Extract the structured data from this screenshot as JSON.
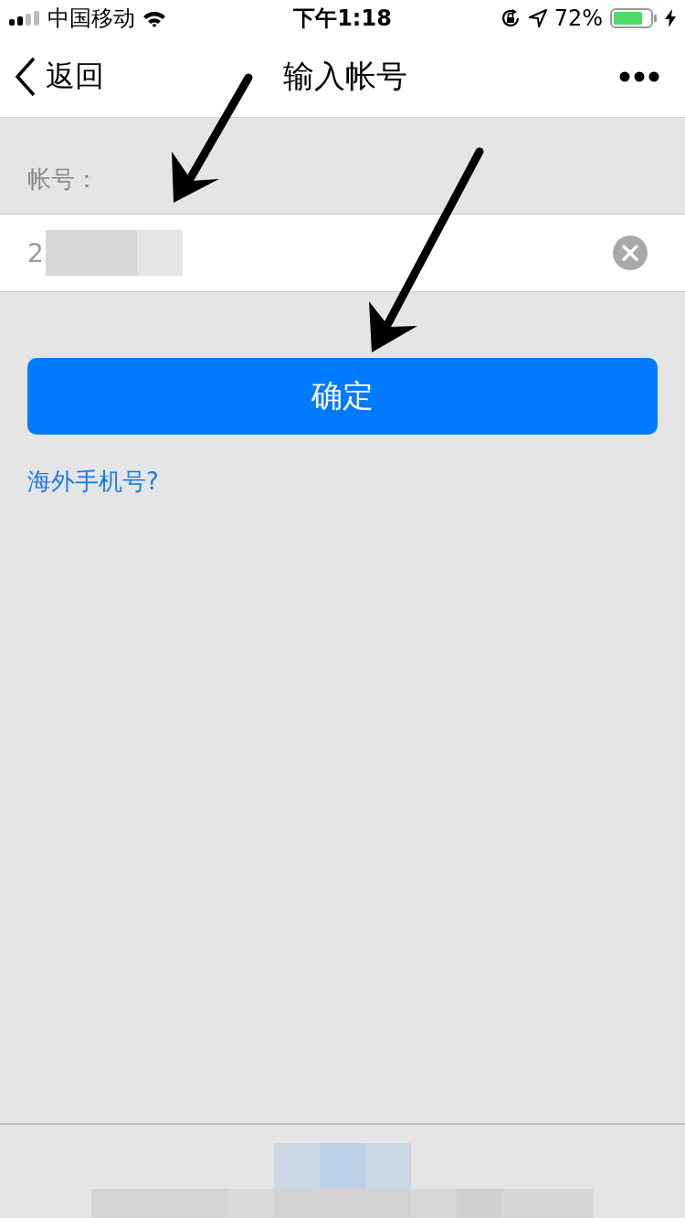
{
  "status_bar": {
    "carrier": "中国移动",
    "time": "下午1:18",
    "battery": "72%"
  },
  "nav_bar": {
    "back": "返回",
    "title": "输入帐号"
  },
  "form": {
    "label": "帐号：",
    "value": "2",
    "button": "确定",
    "link": "海外手机号?"
  }
}
